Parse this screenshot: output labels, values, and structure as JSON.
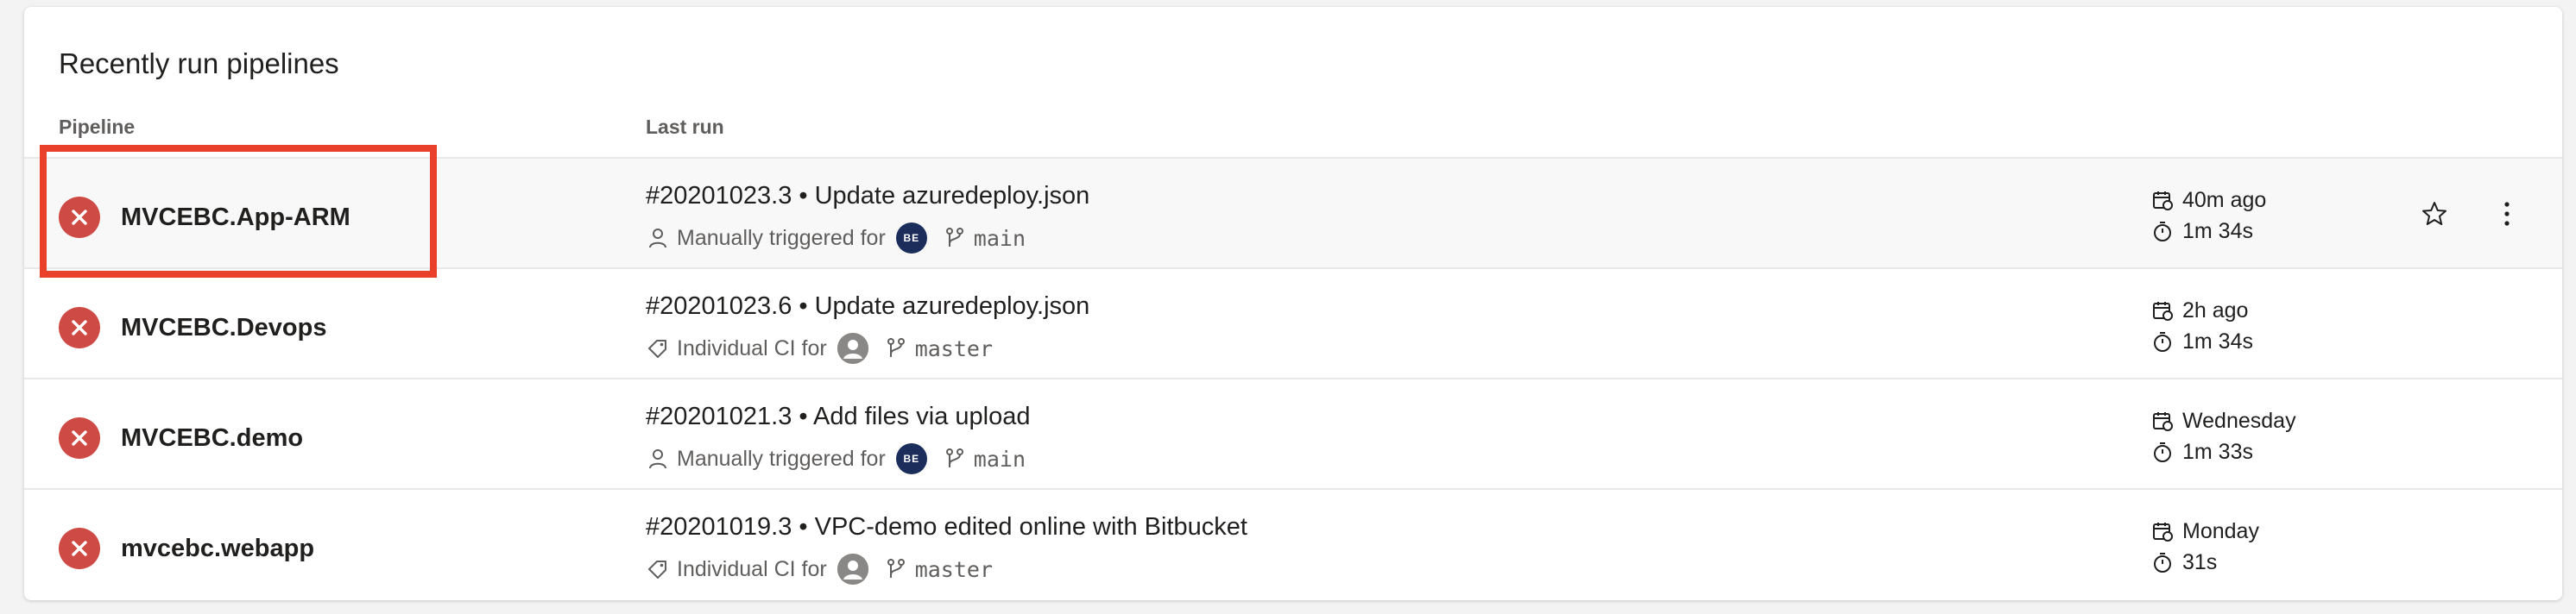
{
  "card": {
    "title": "Recently run pipelines",
    "columns": {
      "pipeline": "Pipeline",
      "last_run": "Last run"
    }
  },
  "rows": [
    {
      "status": "failed",
      "name": "MVCEBC.App-ARM",
      "run_title": "#20201023.3 • Update azuredeploy.json",
      "trigger_icon": "person-icon",
      "trigger": "Manually triggered for",
      "avatar": "BE",
      "branch": "main",
      "when": "40m ago",
      "duration": "1m 34s",
      "selected": true
    },
    {
      "status": "failed",
      "name": "MVCEBC.Devops",
      "run_title": "#20201023.6 • Update azuredeploy.json",
      "trigger_icon": "tag-icon",
      "trigger": "Individual CI for",
      "avatar": "",
      "branch": "master",
      "when": "2h ago",
      "duration": "1m 34s",
      "selected": false
    },
    {
      "status": "failed",
      "name": "MVCEBC.demo",
      "run_title": "#20201021.3 • Add files via upload",
      "trigger_icon": "person-icon",
      "trigger": "Manually triggered for",
      "avatar": "BE",
      "branch": "main",
      "when": "Wednesday",
      "duration": "1m 33s",
      "selected": false
    },
    {
      "status": "failed",
      "name": "mvcebc.webapp",
      "run_title": "#20201019.3 • VPC-demo edited online with Bitbucket",
      "trigger_icon": "tag-icon",
      "trigger": "Individual CI for",
      "avatar": "",
      "branch": "master",
      "when": "Monday",
      "duration": "31s",
      "selected": false
    }
  ],
  "colors": {
    "failed": "#cd4a45",
    "highlight": "#e8402a",
    "avatar_be": "#1c2d5c"
  }
}
